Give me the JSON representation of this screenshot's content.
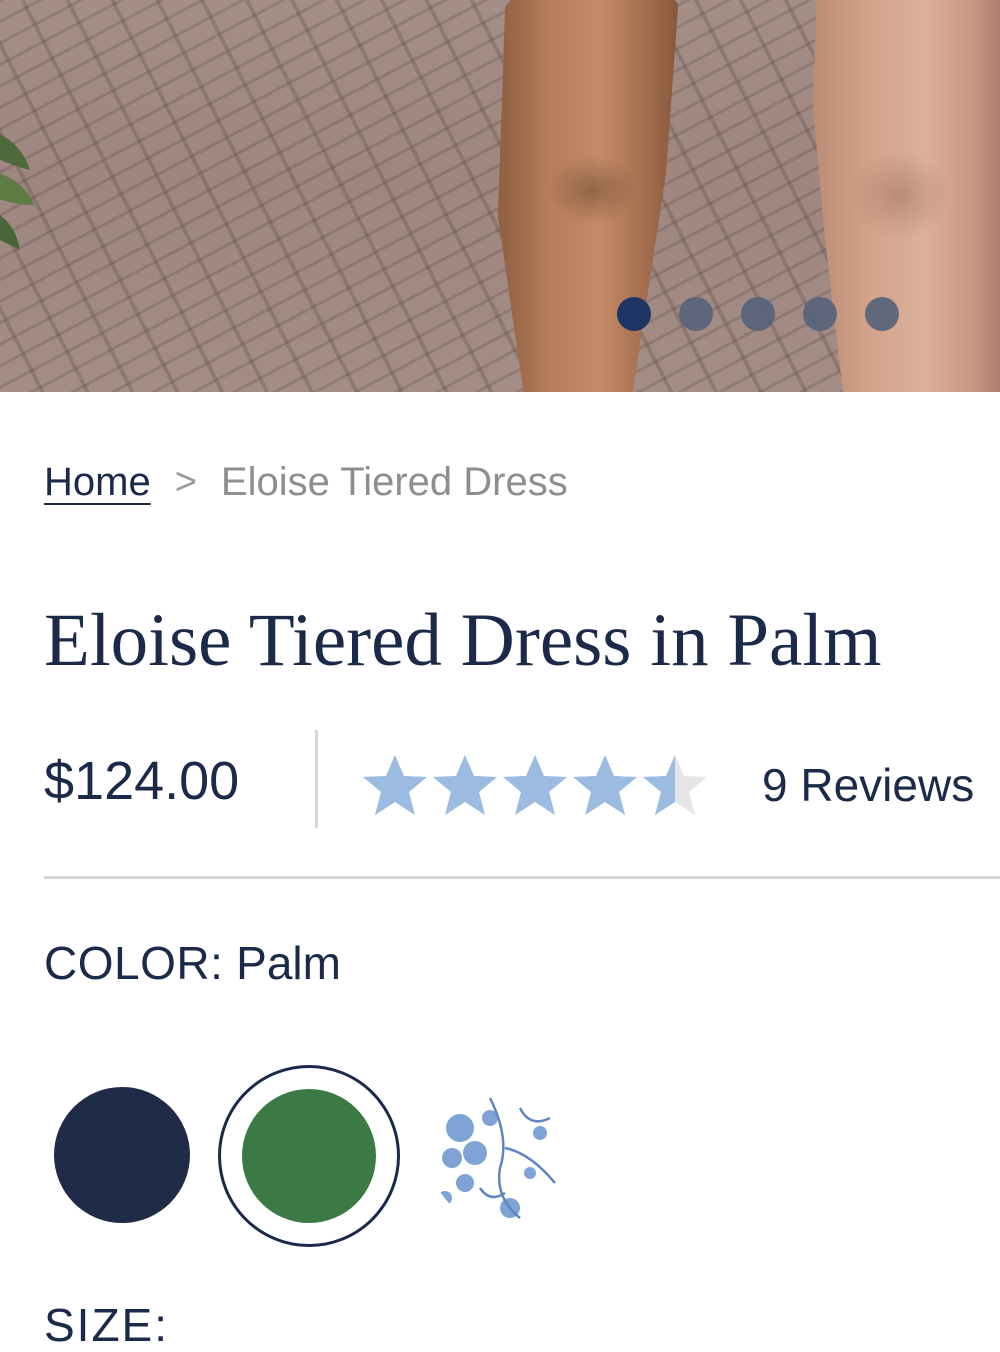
{
  "carousel": {
    "slide_count": 5,
    "active_index": 0,
    "active_color": "#1e3566",
    "inactive_color": "#55627a"
  },
  "breadcrumb": {
    "home": "Home",
    "separator": ">",
    "current": "Eloise Tiered Dress"
  },
  "product": {
    "title": "Eloise Tiered Dress in Palm",
    "price": "$124.00",
    "rating": 4.5,
    "rating_max": 5,
    "star_color": "#9bbbe0",
    "reviews_label": "9 Reviews"
  },
  "color": {
    "label": "COLOR:",
    "selected": "Palm",
    "swatches": [
      {
        "name": "navy-swatch",
        "color": "#202c47",
        "selected": false
      },
      {
        "name": "palm-green-swatch",
        "color": "#3b7a44",
        "selected": true
      },
      {
        "name": "blue-floral-print-swatch",
        "color": "#7fa3d4",
        "selected": false
      }
    ]
  },
  "size": {
    "label": "SIZE:"
  }
}
